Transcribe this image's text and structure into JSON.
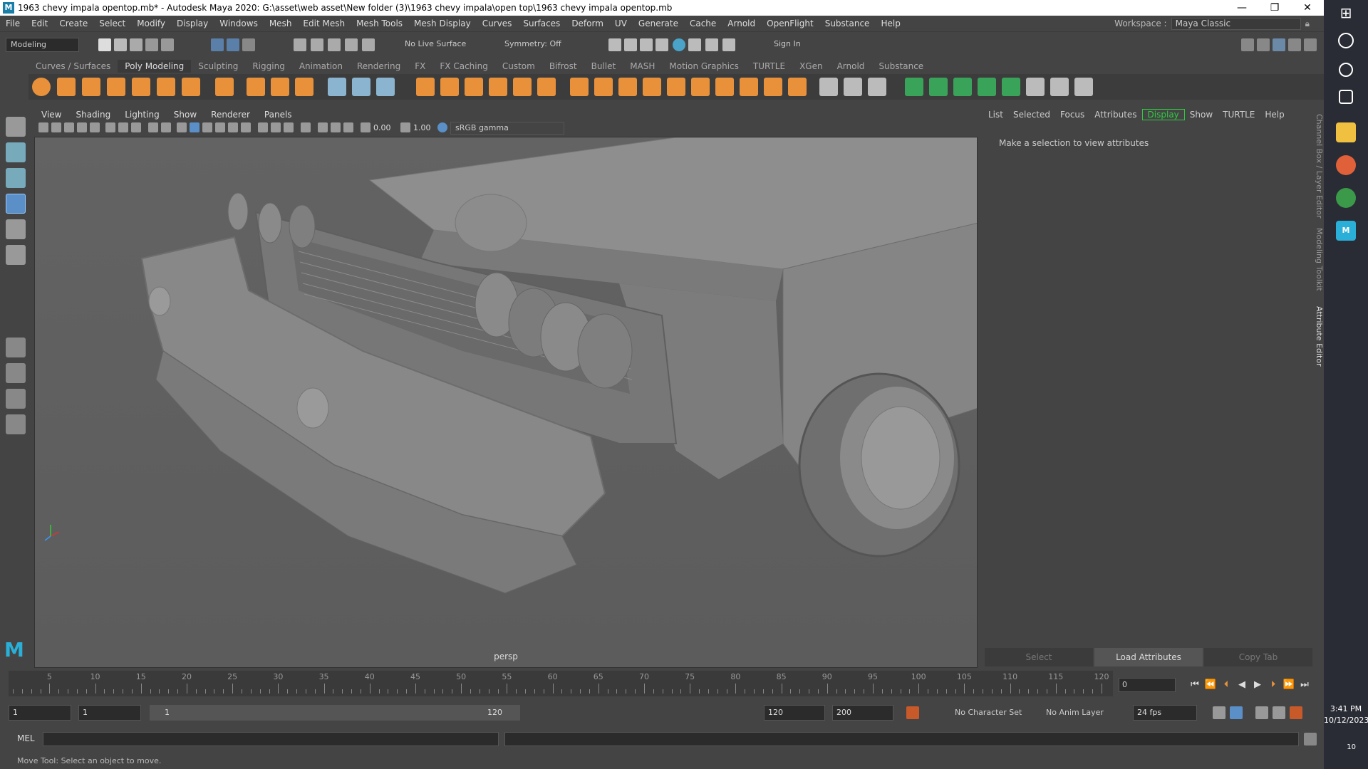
{
  "window": {
    "title": "1963 chevy impala opentop.mb* - Autodesk Maya 2020: G:\\asset\\web asset\\New folder (3)\\1963 chevy impala\\open top\\1963 chevy impala opentop.mb",
    "minimize": "—",
    "maximize": "❐",
    "close": "✕"
  },
  "menubar": [
    "File",
    "Edit",
    "Create",
    "Select",
    "Modify",
    "Display",
    "Windows",
    "Mesh",
    "Edit Mesh",
    "Mesh Tools",
    "Mesh Display",
    "Curves",
    "Surfaces",
    "Deform",
    "UV",
    "Generate",
    "Cache",
    "Arnold",
    "OpenFlight",
    "Substance",
    "Help"
  ],
  "workspace": {
    "label": "Workspace :",
    "value": "Maya Classic"
  },
  "statusline": {
    "menuset": "Modeling",
    "live_surface": "No Live Surface",
    "symmetry": "Symmetry: Off",
    "sign_in": "Sign In"
  },
  "shelf_tabs": [
    "Curves / Surfaces",
    "Poly Modeling",
    "Sculpting",
    "Rigging",
    "Animation",
    "Rendering",
    "FX",
    "FX Caching",
    "Custom",
    "Bifrost",
    "Bullet",
    "MASH",
    "Motion Graphics",
    "TURTLE",
    "XGen",
    "Arnold",
    "Substance"
  ],
  "shelf_active": "Poly Modeling",
  "viewport": {
    "menus": [
      "View",
      "Shading",
      "Lighting",
      "Show",
      "Renderer",
      "Panels"
    ],
    "exposure": "0.00",
    "gamma": "1.00",
    "color_space": "sRGB gamma",
    "camera_label": "persp"
  },
  "attribute_editor": {
    "tabs": [
      "List",
      "Selected",
      "Focus",
      "Attributes",
      "Display",
      "Show",
      "TURTLE",
      "Help"
    ],
    "active_tab": "Display",
    "message": "Make a selection to view attributes",
    "buttons": [
      "Select",
      "Load Attributes",
      "Copy Tab"
    ],
    "side_tabs": [
      "Channel Box / Layer Editor",
      "Modeling Toolkit",
      "Attribute Editor"
    ]
  },
  "timeline": {
    "labels": [
      "5",
      "10",
      "15",
      "20",
      "25",
      "30",
      "35",
      "40",
      "45",
      "50",
      "55",
      "60",
      "65",
      "70",
      "75",
      "80",
      "85",
      "90",
      "95",
      "100",
      "105",
      "110",
      "115",
      "120"
    ],
    "current_frame": "0"
  },
  "range": {
    "start": "1",
    "playback_start": "1",
    "slider_start": "1",
    "slider_end": "120",
    "playback_end": "120",
    "end": "200",
    "character_set": "No Character Set",
    "anim_layer": "No Anim Layer",
    "fps": "24 fps"
  },
  "cmdline": {
    "label": "MEL"
  },
  "helpline": "Move Tool: Select an object to move.",
  "taskbar": {
    "time": "3:41 PM",
    "date": "10/12/2023",
    "notifications": "10"
  }
}
